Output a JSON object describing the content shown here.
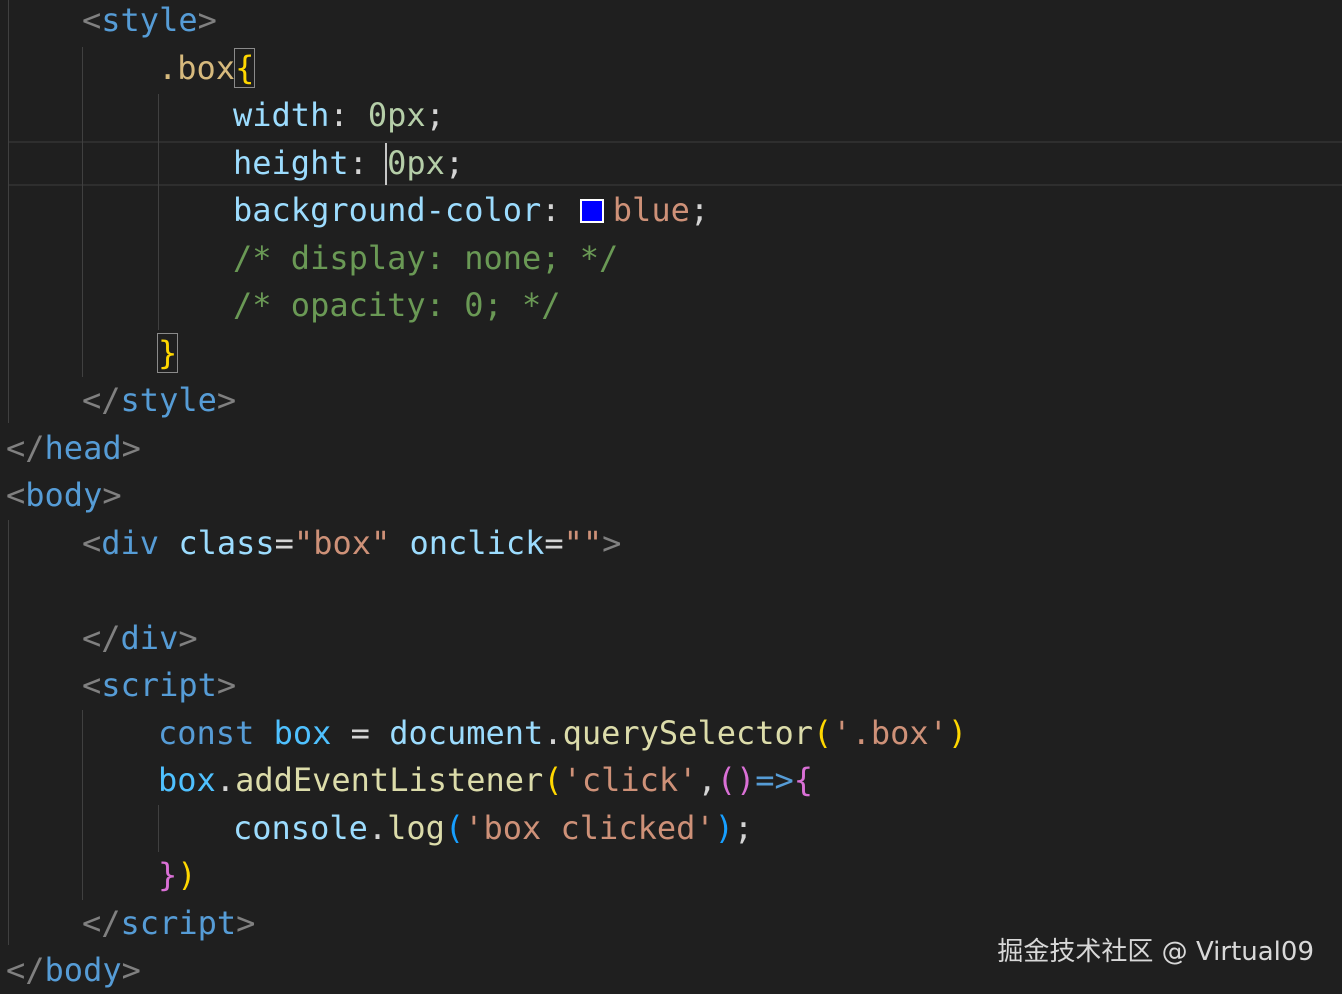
{
  "editor": {
    "lines": {
      "l1": {
        "open": "<",
        "tag": "style",
        "close": ">"
      },
      "l2": {
        "selector": ".box",
        "brace": "{"
      },
      "l3": {
        "prop": "width",
        "colon": ": ",
        "value": "0px",
        "semi": ";"
      },
      "l4": {
        "prop": "height",
        "colon": ": ",
        "value": "0px",
        "semi": ";"
      },
      "l5": {
        "prop": "background-color",
        "colon": ": ",
        "value": "blue",
        "semi": ";"
      },
      "l6": {
        "comment": "/* display: none; */"
      },
      "l7": {
        "comment": "/* opacity: 0; */"
      },
      "l8": {
        "brace": "}"
      },
      "l9": {
        "open": "</",
        "tag": "style",
        "close": ">"
      },
      "l10": {
        "open": "</",
        "tag": "head",
        "close": ">"
      },
      "l11": {
        "open": "<",
        "tag": "body",
        "close": ">"
      },
      "l12": {
        "open": "<",
        "tag": "div",
        "attr1": "class",
        "eq1": "=",
        "val1": "\"box\"",
        "attr2": "onclick",
        "eq2": "=",
        "val2": "\"\"",
        "close": ">"
      },
      "l14": {
        "open": "</",
        "tag": "div",
        "close": ">"
      },
      "l15": {
        "open": "<",
        "tag": "script",
        "close": ">"
      },
      "l16": {
        "kw": "const",
        "var": "box",
        "op": " = ",
        "obj": "document",
        "dot": ".",
        "fn": "querySelector",
        "p_open": "(",
        "arg": "'.box'",
        "p_close": ")"
      },
      "l17": {
        "var": "box",
        "dot": ".",
        "fn": "addEventListener",
        "p_open": "(",
        "arg": "'click'",
        "comma": ",",
        "params": "()",
        "arrow": "=>",
        "brace": "{"
      },
      "l18": {
        "obj": "console",
        "dot": ".",
        "fn": "log",
        "p_open": "(",
        "arg": "'box clicked'",
        "p_close": ")",
        "semi": ";"
      },
      "l19": {
        "brace": "}",
        "paren": ")"
      },
      "l20": {
        "open": "</",
        "tag": "script",
        "close": ">"
      },
      "l21": {
        "open": "</",
        "tag": "body",
        "close": ">"
      }
    },
    "swatch_color": "#0000ff"
  },
  "watermark": "掘金技术社区 @ Virtual09"
}
